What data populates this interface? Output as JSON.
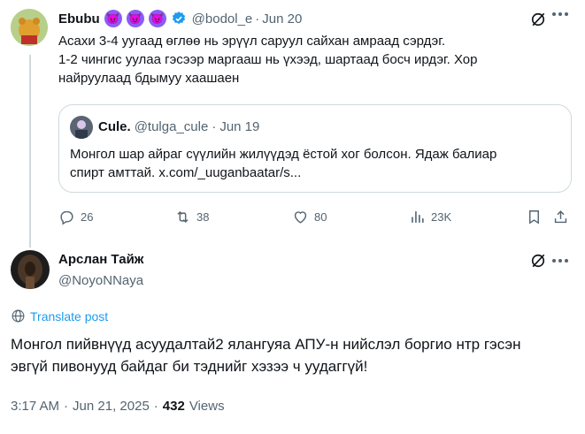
{
  "tweet1": {
    "name": "Ebubu",
    "name_emojis": [
      "😈",
      "😈",
      "😈"
    ],
    "handle": "@bodol_e",
    "sep": "·",
    "date": "Jun 20",
    "line1": "Асахи 3-4 уугаад өглөө нь эрүүл саруул сайхан амраад сэрдэг.",
    "line2": "1-2 чингис уулаа гэсээр маргааш нь үхээд, шартаад босч ирдэг. Хор",
    "line3": "найруулаад бдымуу хаашаен",
    "quote": {
      "name": "Cule.",
      "handle": "@tulga_cule",
      "sep": "·",
      "date": "Jun 19",
      "line1": "Монгол шар айраг сүүлийн жилүүдэд ёстой хог болсон. Ядаж балиар",
      "line2": "спирт амттай. x.com/_uuganbaatar/s..."
    },
    "actions": {
      "replies": "26",
      "reposts": "38",
      "likes": "80",
      "views": "23K"
    }
  },
  "tweet2": {
    "name": "Арслан Тайж",
    "handle": "@NoyoNNaya",
    "translate": "Translate post",
    "line1": "Монгол пийвнүүд асуудалтай2 ялангуяа АПУ-н нийслэл боргио нтр гэсэн",
    "line2": "эвгүй пивонууд байдаг би тэднийг хэзээ ч уудаггүй!",
    "time": "3:17 AM",
    "sep": "·",
    "date": "Jun 21, 2025",
    "sep2": "·",
    "views_count": "432",
    "views_label": "Views"
  },
  "colors": {
    "accent": "#1d9bf0",
    "muted": "#536471",
    "border": "#cfd9de",
    "verified": "#1d9bf0"
  }
}
